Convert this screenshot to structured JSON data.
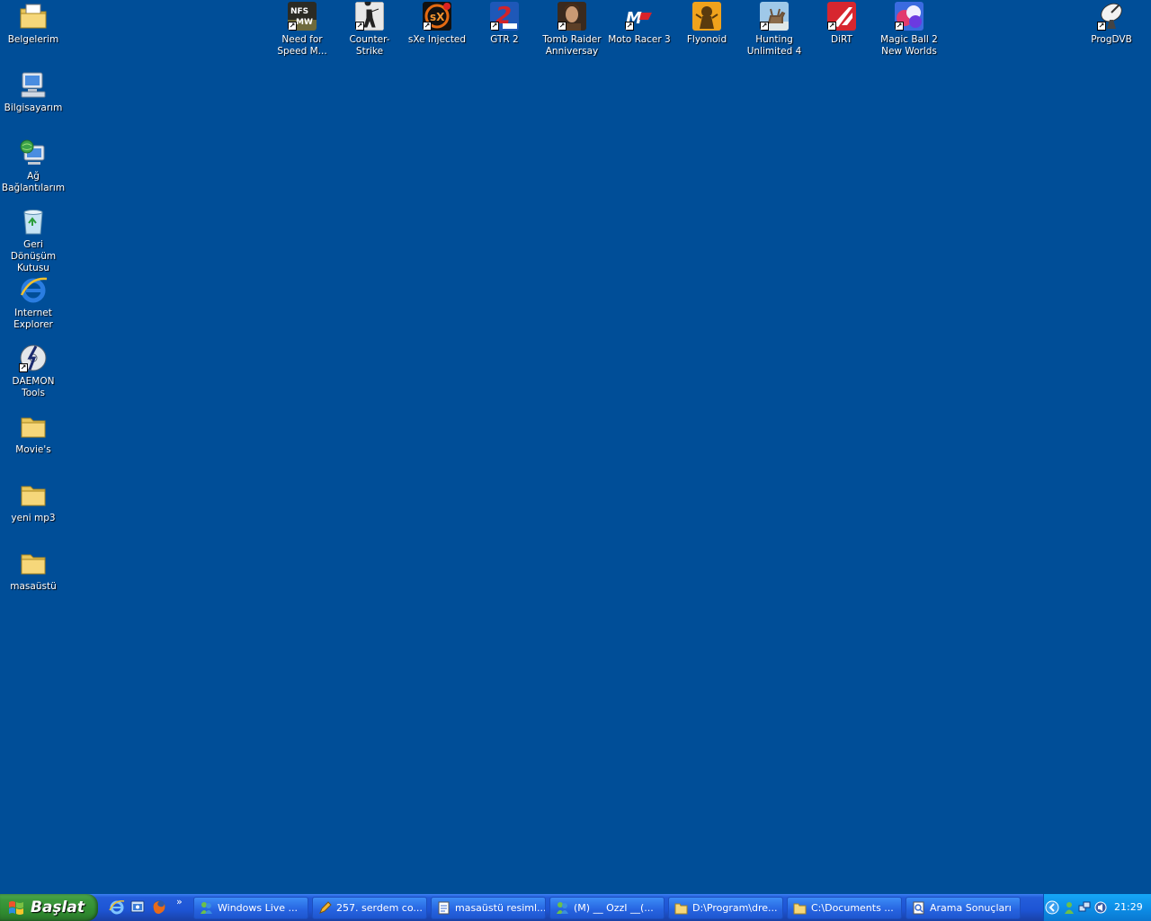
{
  "desktop": {
    "left_icons": [
      {
        "label": "Belgelerim",
        "icon": "my-documents-icon"
      },
      {
        "label": "Bilgisayarım",
        "icon": "my-computer-icon"
      },
      {
        "label": "Ağ Bağlantılarım",
        "icon": "network-places-icon"
      },
      {
        "label": "Geri Dönüşüm Kutusu",
        "icon": "recycle-bin-icon"
      },
      {
        "label": "Internet Explorer",
        "icon": "internet-explorer-icon"
      },
      {
        "label": "DAEMON Tools",
        "icon": "daemon-tools-icon"
      },
      {
        "label": "Movie's",
        "icon": "folder-icon"
      },
      {
        "label": "yeni mp3",
        "icon": "folder-icon"
      },
      {
        "label": "masaüstü",
        "icon": "folder-icon"
      }
    ],
    "top_icons": [
      {
        "label": "Need for Speed M...",
        "icon": "nfs-most-wanted-icon"
      },
      {
        "label": "Counter-Strike",
        "icon": "counter-strike-icon"
      },
      {
        "label": "sXe Injected",
        "icon": "sxe-injected-icon"
      },
      {
        "label": "GTR 2",
        "icon": "gtr2-icon"
      },
      {
        "label": "Tomb Raider Anniversay",
        "icon": "tomb-raider-icon"
      },
      {
        "label": "Moto Racer 3",
        "icon": "moto-racer-icon"
      },
      {
        "label": "Flyonoid",
        "icon": "flyonoid-icon"
      },
      {
        "label": "Hunting Unlimited 4",
        "icon": "hunting-unlimited-icon"
      },
      {
        "label": "DiRT",
        "icon": "dirt-icon"
      },
      {
        "label": "Magic Ball 2 New Worlds",
        "icon": "magic-ball-icon"
      }
    ],
    "right_icons": [
      {
        "label": "ProgDVB",
        "icon": "satellite-dish-icon"
      }
    ]
  },
  "taskbar": {
    "start_label": "Başlat",
    "quick_launch": [
      "internet-explorer-icon",
      "show-desktop-icon",
      "firefox-icon"
    ],
    "overflow_label": "»",
    "tasks": [
      {
        "label": "Windows Live ...",
        "icon": "messenger-icon"
      },
      {
        "label": "257. serdem co...",
        "icon": "pencil-icon"
      },
      {
        "label": "masaüstü resiml...",
        "icon": "document-icon"
      },
      {
        "label": "(M) __ OzzI __(...",
        "icon": "messenger-icon"
      },
      {
        "label": "D:\\Program\\dre...",
        "icon": "folder-icon"
      },
      {
        "label": "C:\\Documents ...",
        "icon": "folder-icon"
      },
      {
        "label": "Arama Sonuçları",
        "icon": "search-results-icon"
      }
    ],
    "tray": {
      "clock": "21:29",
      "icons": [
        "messenger-tray-icon",
        "network-tray-icon",
        "volume-tray-icon"
      ]
    }
  },
  "colors": {
    "desktop_background": "#004E98",
    "taskbar_blue": "#245EDB",
    "start_green": "#3D9A3D",
    "tray_blue": "#0D8FE8"
  }
}
